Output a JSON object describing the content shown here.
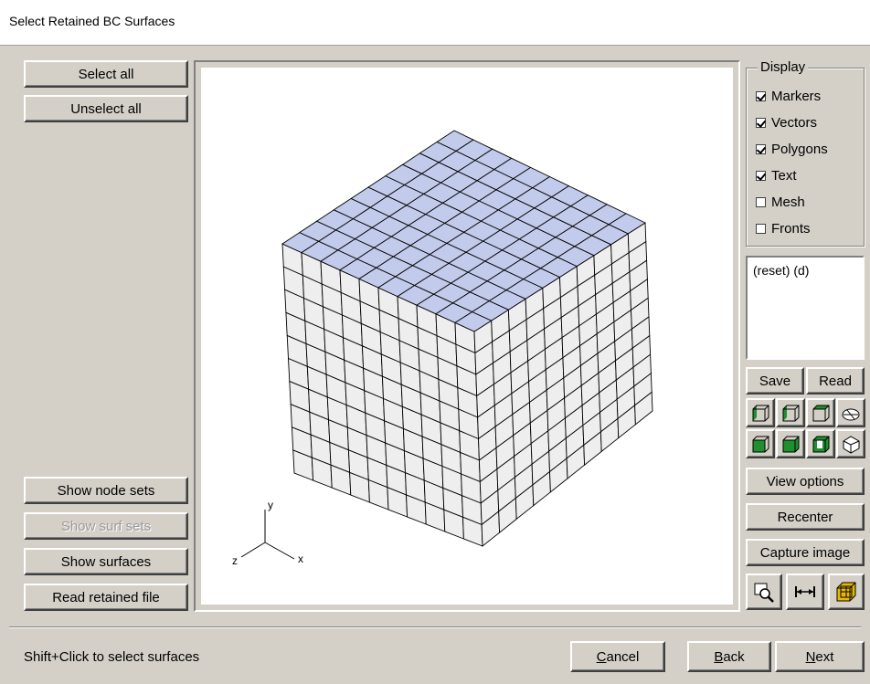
{
  "window": {
    "title": "Select Retained BC Surfaces"
  },
  "left_panel": {
    "select_all": "Select all",
    "unselect_all": "Unselect all",
    "show_node_sets": "Show node sets",
    "show_surf_sets": "Show surf sets",
    "show_surfaces": "Show surfaces",
    "read_retained_file": "Read retained file"
  },
  "display": {
    "title": "Display",
    "options": [
      {
        "label": "Markers",
        "checked": true
      },
      {
        "label": "Vectors",
        "checked": true
      },
      {
        "label": "Polygons",
        "checked": true
      },
      {
        "label": "Text",
        "checked": true
      },
      {
        "label": "Mesh",
        "checked": false
      },
      {
        "label": "Fronts",
        "checked": false
      }
    ]
  },
  "views_list": {
    "items": [
      "(reset) (d)"
    ]
  },
  "view_buttons": {
    "save": "Save",
    "read": "Read"
  },
  "right_panel": {
    "view_options": "View options",
    "recenter": "Recenter",
    "capture_image": "Capture image"
  },
  "axes": {
    "x": "x",
    "y": "y",
    "z": "z"
  },
  "colors": {
    "top_face": "#c2cbeb",
    "side_face": "#eeeeee",
    "edge": "#000000",
    "highlight_green": "#1f8f2f",
    "cube_icon": "#e8b800"
  },
  "footer": {
    "status": "Shift+Click to select surfaces",
    "cancel_prefix": "",
    "cancel_key": "C",
    "cancel_rest": "ancel",
    "back_key": "B",
    "back_rest": "ack",
    "next_key": "N",
    "next_rest": "ext"
  }
}
